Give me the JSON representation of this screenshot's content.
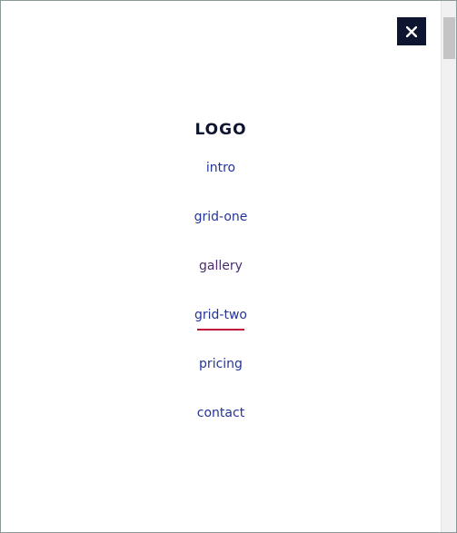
{
  "close_icon": "close-icon",
  "logo": "LOGO",
  "nav": {
    "items": [
      {
        "label": "intro"
      },
      {
        "label": "grid-one"
      },
      {
        "label": "gallery"
      },
      {
        "label": "grid-two",
        "active": true
      },
      {
        "label": "pricing"
      },
      {
        "label": "contact"
      }
    ]
  },
  "colors": {
    "link": "#24349a",
    "active_underline": "#c0143c",
    "close_bg": "#0d1530"
  }
}
